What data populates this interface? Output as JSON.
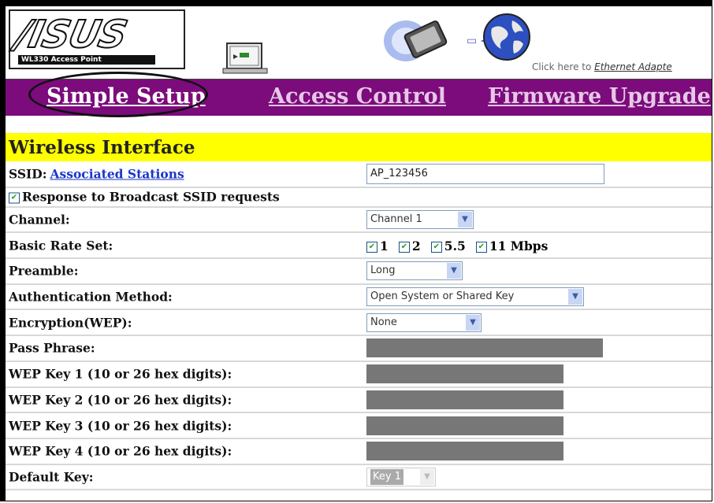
{
  "header": {
    "logo_text": "/ISUS",
    "logo_sub": "WL330 Access Point",
    "click_prefix": "Click here to ",
    "click_link": "Ethernet Adapte"
  },
  "nav": {
    "simple_setup": "Simple Setup",
    "access_control": "Access Control",
    "firmware_upgrade": "Firmware Upgrade"
  },
  "section_title": "Wireless Interface",
  "form": {
    "ssid_label": "SSID:",
    "ssid_link": "Associated Stations",
    "ssid_value": "AP_123456",
    "broadcast_label": "Response to Broadcast SSID requests",
    "channel_label": "Channel:",
    "channel_value": "Channel 1",
    "basic_rate_label": "Basic Rate Set:",
    "rates": [
      "1",
      "2",
      "5.5",
      "11 Mbps"
    ],
    "preamble_label": "Preamble:",
    "preamble_value": "Long",
    "auth_label": "Authentication Method:",
    "auth_value": "Open System or Shared Key",
    "encryption_label": "Encryption(WEP):",
    "encryption_value": "None",
    "pass_phrase_label": "Pass Phrase:",
    "wep_key1_label": "WEP Key 1 (10 or 26 hex digits):",
    "wep_key2_label": "WEP Key 2 (10 or 26 hex digits):",
    "wep_key3_label": "WEP Key 3 (10 or 26 hex digits):",
    "wep_key4_label": "WEP Key 4 (10 or 26 hex digits):",
    "default_key_label": "Default Key:",
    "default_key_value": "Key 1"
  },
  "colors": {
    "navbar": "#7c0b7c",
    "section_bar": "#ffff00",
    "link": "#1a36c8",
    "disabled_field": "#777777"
  },
  "icons": [
    "laptop-icon",
    "disk-icon",
    "globe-icon",
    "checkbox-icon",
    "chevron-down-icon"
  ]
}
